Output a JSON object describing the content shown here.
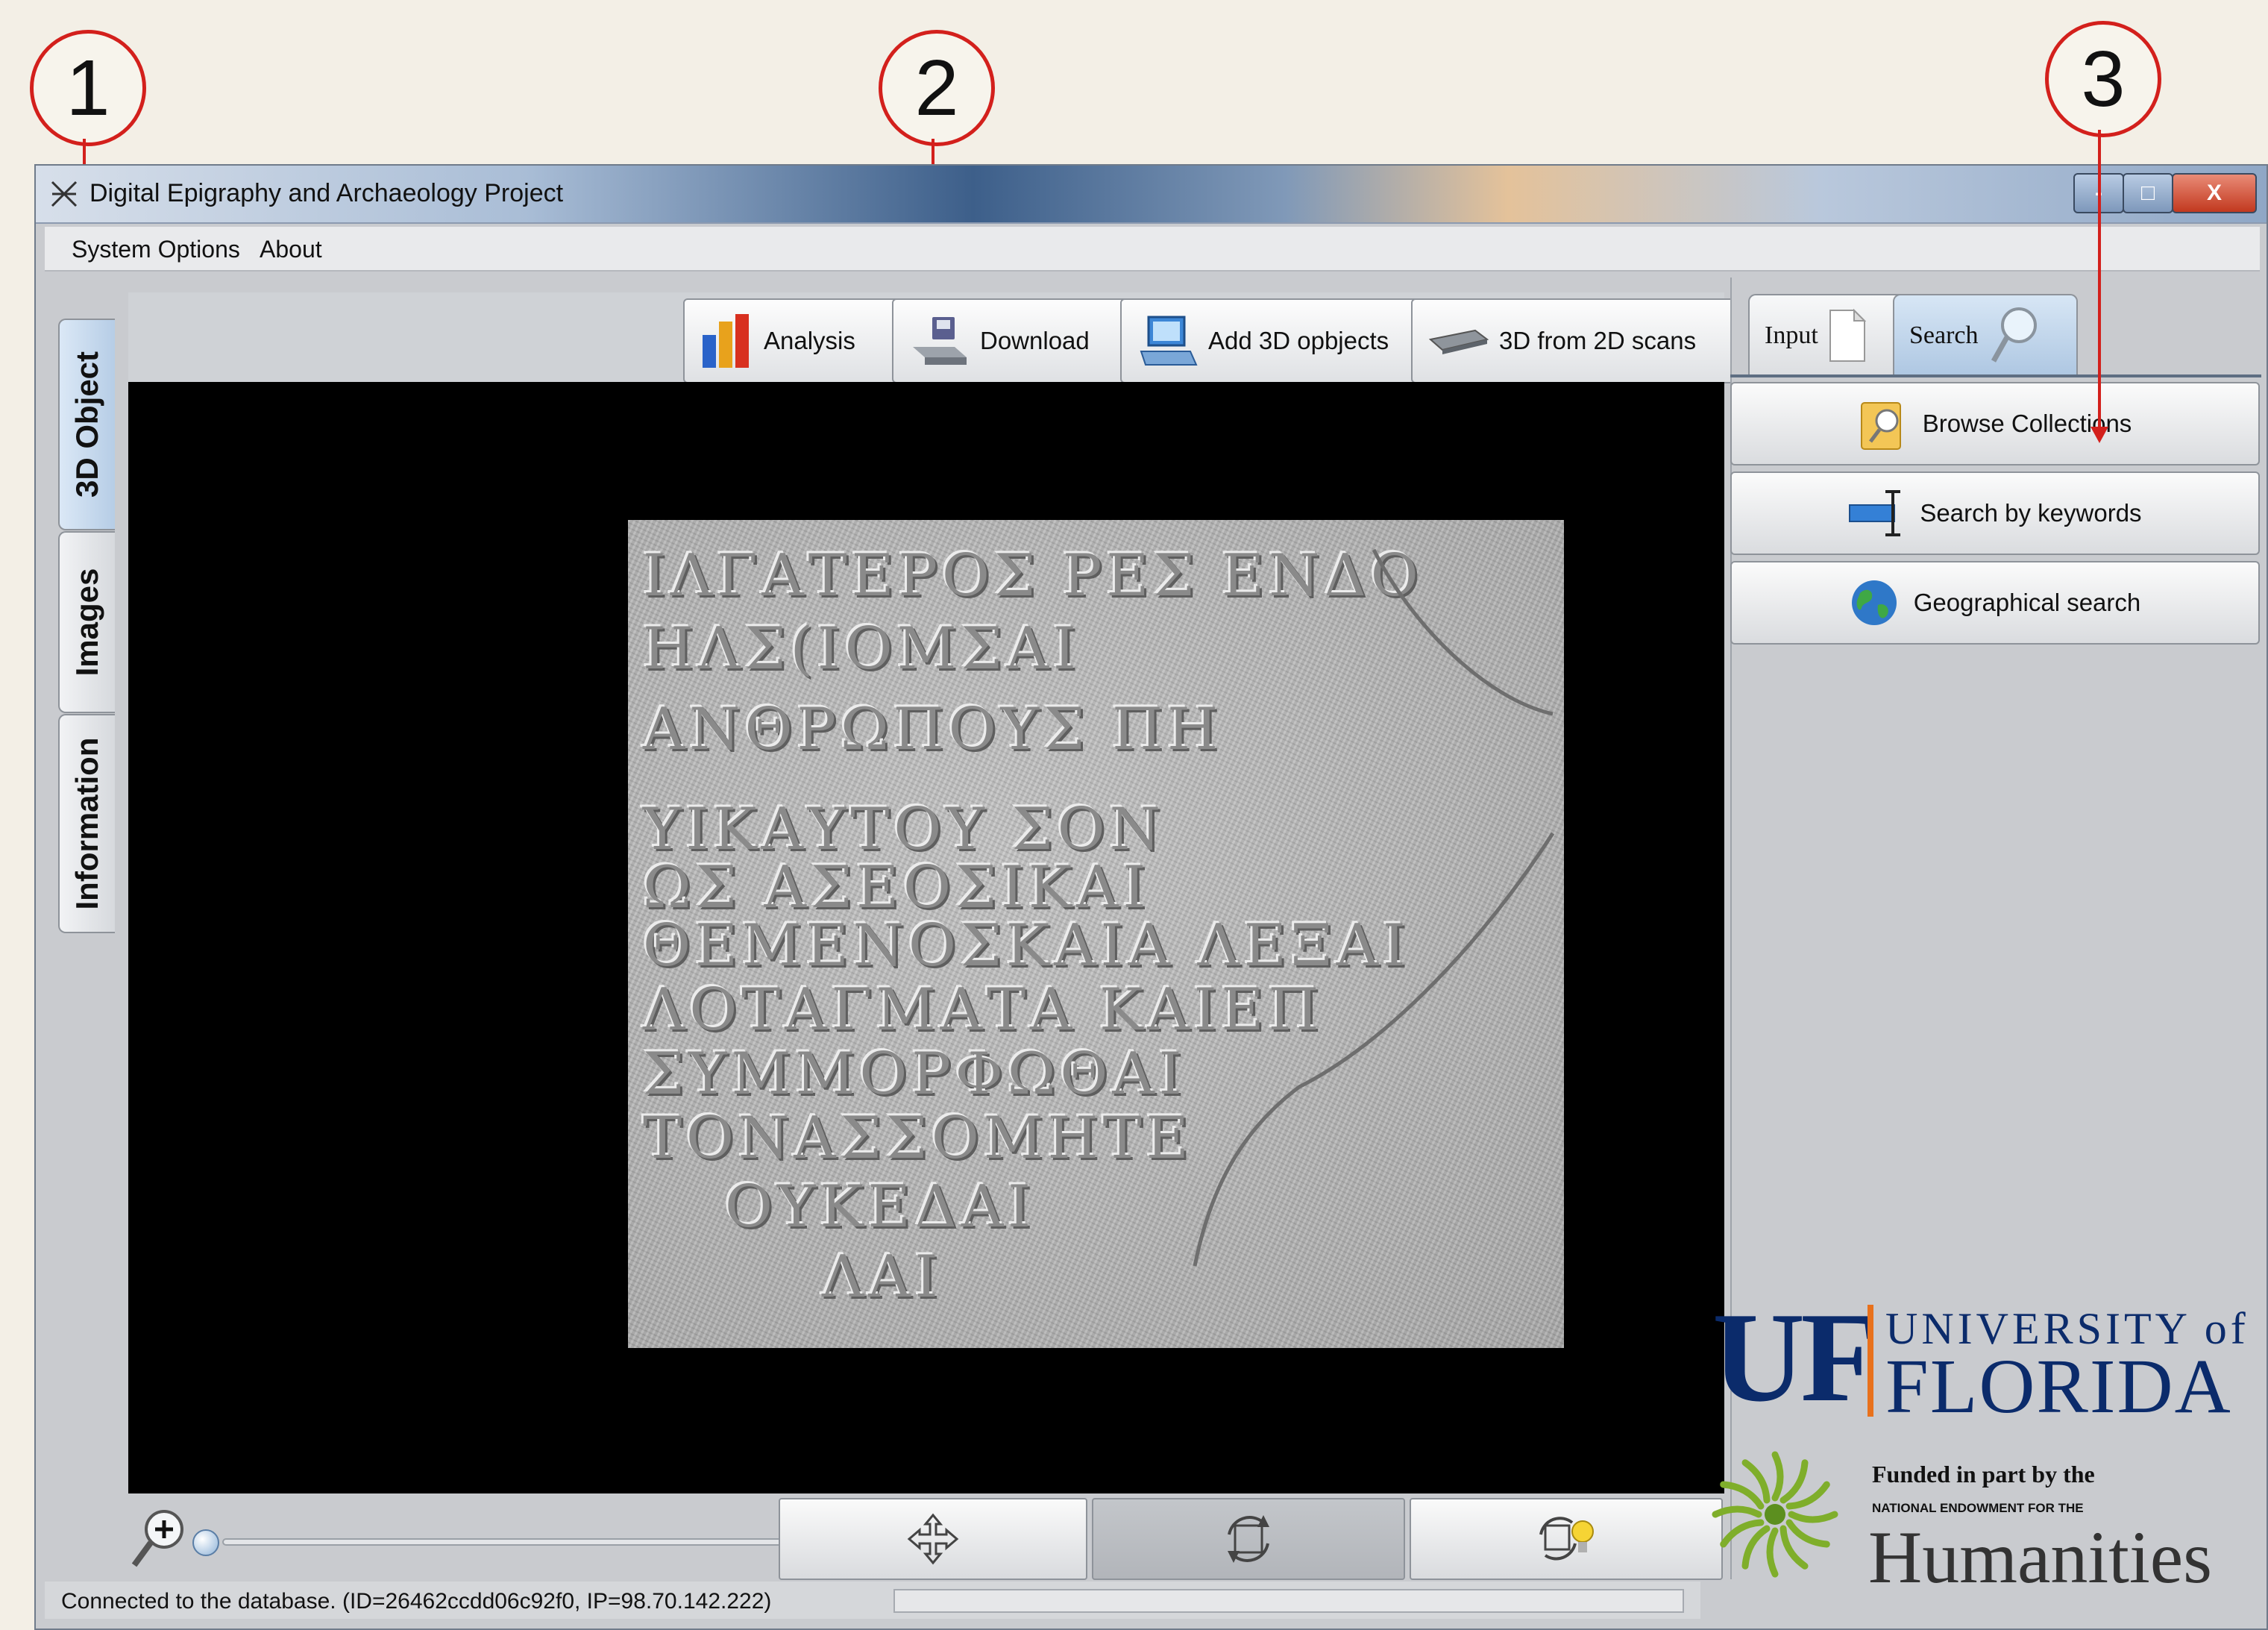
{
  "callouts": [
    "1",
    "2",
    "3"
  ],
  "window": {
    "title": "Digital Epigraphy and Archaeology Project",
    "controls": {
      "minimize": "-",
      "maximize": "□",
      "close": "X"
    }
  },
  "menu": [
    "System Options",
    "About"
  ],
  "side_tabs": [
    {
      "label": "3D Object",
      "active": true
    },
    {
      "label": "Images",
      "active": false
    },
    {
      "label": "Information",
      "active": false
    }
  ],
  "toolbar": [
    {
      "label": "Analysis",
      "icon": "bar-chart-icon"
    },
    {
      "label": "Download",
      "icon": "download-drive-icon"
    },
    {
      "label": "Add 3D opbjects",
      "icon": "add-object-computer-icon"
    },
    {
      "label": "3D from 2D scans",
      "icon": "scanner-icon"
    }
  ],
  "viewer": {
    "inscription_lines": [
      "ΙΛΓΑΤΕΡΟΣ ΡΕΣ ΕΝΔΟ",
      "ΗΛΣ(ΙΟΜΣΑΙ",
      "ΑΝΘΡΩΠΟΥΣ ΠΗ",
      "ΥΙΚΑΥΤΟΥ ΣΟΝ",
      "ΩΣ ΑΣΕΟΣΙΚΑΙ",
      "ΘΕΜΕΝΟΣΚΑΙΑ ΛΕΞΑΙ",
      "ΛΟΤΑΓΜΑΤΑ ΚΑΙΕΠ",
      "ΣΥΜΜΟΡΦΩΘΑΙ",
      "ΤΟΝΑΣΣΟΜΗΤΕ",
      "ΟΥΚΕΔΑΙ",
      "ΛΑΙ"
    ]
  },
  "bottom_controls": [
    {
      "icon": "zoom-in-icon"
    },
    {
      "icon": "move-arrows-icon"
    },
    {
      "icon": "rotate-icon",
      "pressed": true
    },
    {
      "icon": "rotate-light-icon"
    }
  ],
  "status": {
    "text": "Connected to the database. (ID=26462ccdd06c92f0, IP=98.70.142.222)"
  },
  "right_tabs": [
    {
      "label": "Input",
      "icon": "document-icon",
      "active": false
    },
    {
      "label": "Search",
      "icon": "magnifier-icon",
      "active": true
    }
  ],
  "search_buttons": [
    {
      "label": "Browse Collections",
      "icon": "folder-search-icon"
    },
    {
      "label": "Search by keywords",
      "icon": "text-cursor-icon"
    },
    {
      "label": "Geographical search",
      "icon": "globe-icon"
    }
  ],
  "logos": {
    "uf": {
      "letters": "UF",
      "line1": "UNIVERSITY of",
      "line2": "FLORIDA"
    },
    "neh": {
      "funded": "Funded in part by the",
      "national": "NATIONAL ENDOWMENT FOR THE",
      "humanities": "Humanities"
    }
  },
  "colors": {
    "callout_red": "#d3201c",
    "uf_blue": "#0b2b6b",
    "uf_orange": "#e8711c",
    "neh_green": "#7fae2b"
  }
}
